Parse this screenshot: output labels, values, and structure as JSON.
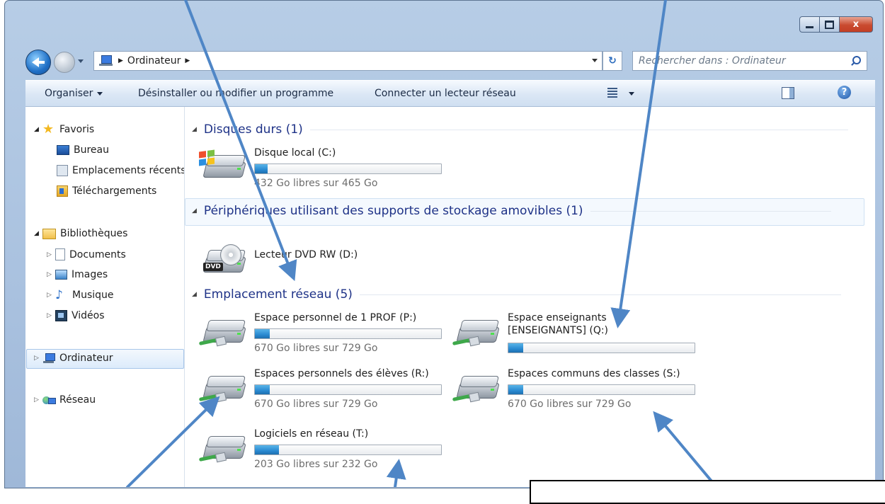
{
  "window": {
    "close_glyph": "x"
  },
  "address_bar": {
    "path": [
      "Ordinateur"
    ],
    "refresh_glyph": "↻",
    "search_placeholder": "Rechercher dans : Ordinateur"
  },
  "toolbar": {
    "organize": "Organiser",
    "uninstall": "Désinstaller ou modifier un programme",
    "map_drive": "Connecter un lecteur réseau",
    "help_glyph": "?"
  },
  "nav": {
    "favorites": "Favoris",
    "fav_items": [
      "Bureau",
      "Emplacements récents",
      "Téléchargements"
    ],
    "libraries": "Bibliothèques",
    "lib_items": [
      "Documents",
      "Images",
      "Musique",
      "Vidéos"
    ],
    "computer": "Ordinateur",
    "network": "Réseau"
  },
  "groups": {
    "hard_disks": "Disques durs (1)",
    "removable": "Périphériques utilisant des supports de stockage amovibles (1)",
    "network": "Emplacement réseau (5)"
  },
  "drives": {
    "c": {
      "name": "Disque local (C:)",
      "free": "432 Go libres sur 465 Go",
      "used_fraction": 0.07
    },
    "d": {
      "name": "Lecteur DVD RW (D:)"
    },
    "p": {
      "name": "Espace personnel de 1 PROF (P:)",
      "free": "670 Go libres sur 729 Go",
      "used_fraction": 0.08
    },
    "q": {
      "name": "Espace enseignants [ENSEIGNANTS] (Q:)",
      "used_fraction": 0.08
    },
    "r": {
      "name": "Espaces personnels des élèves (R:)",
      "free": "670 Go libres sur 729 Go",
      "used_fraction": 0.08
    },
    "s": {
      "name": "Espaces communs des classes (S:)",
      "free": "670 Go libres sur 729 Go",
      "used_fraction": 0.08
    },
    "t": {
      "name": "Logiciels en réseau (T:)",
      "free": "203 Go libres sur 232 Go",
      "used_fraction": 0.13
    }
  },
  "colors": {
    "annotation_arrow": "#4f86c6",
    "group_header": "#1e3287"
  }
}
